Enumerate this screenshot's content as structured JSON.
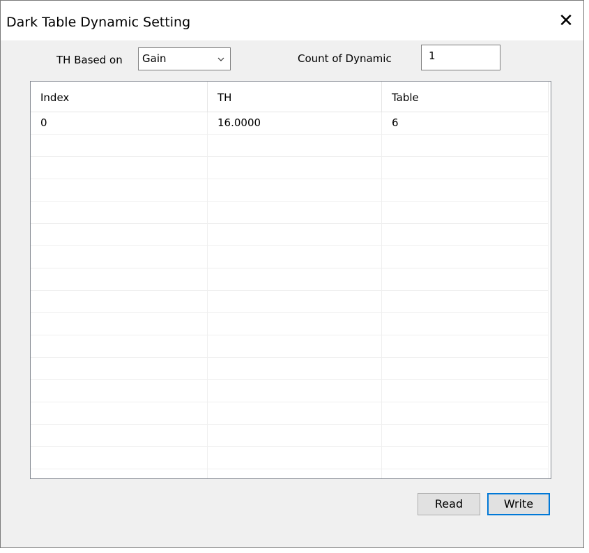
{
  "window": {
    "title": "Dark Table Dynamic Setting",
    "close_glyph": "✕"
  },
  "controls": {
    "th_based_on_label": "TH Based on",
    "th_based_on_value": "Gain",
    "count_label": "Count of Dynamic",
    "count_value": "1"
  },
  "table": {
    "columns": [
      "Index",
      "TH",
      "Table"
    ],
    "rows": [
      [
        "0",
        "16.0000",
        "6"
      ],
      [
        "",
        "",
        ""
      ],
      [
        "",
        "",
        ""
      ],
      [
        "",
        "",
        ""
      ],
      [
        "",
        "",
        ""
      ],
      [
        "",
        "",
        ""
      ],
      [
        "",
        "",
        ""
      ],
      [
        "",
        "",
        ""
      ],
      [
        "",
        "",
        ""
      ],
      [
        "",
        "",
        ""
      ],
      [
        "",
        "",
        ""
      ],
      [
        "",
        "",
        ""
      ],
      [
        "",
        "",
        ""
      ],
      [
        "",
        "",
        ""
      ],
      [
        "",
        "",
        ""
      ],
      [
        "",
        "",
        ""
      ],
      [
        "",
        "",
        ""
      ]
    ]
  },
  "buttons": {
    "read": "Read",
    "write": "Write"
  },
  "colors": {
    "default_button_border": "#0078d7",
    "dialog_bg": "#f0f0f0"
  }
}
